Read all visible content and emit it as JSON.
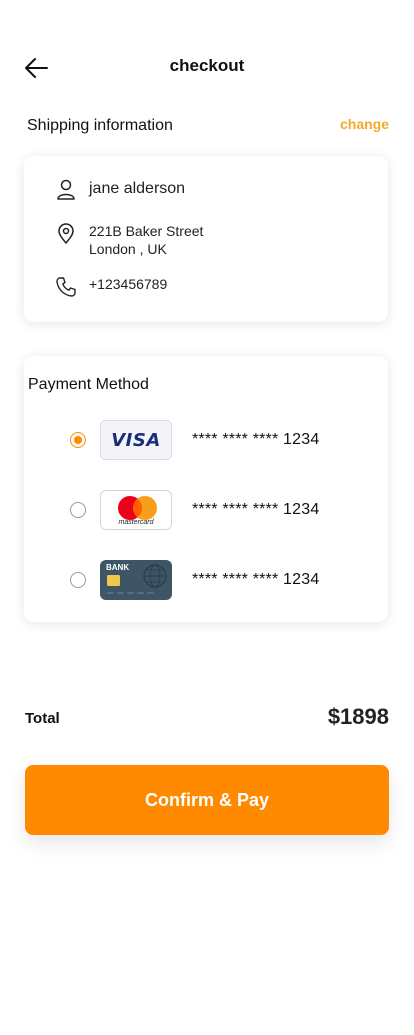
{
  "header": {
    "title": "checkout"
  },
  "shipping": {
    "title": "Shipping information",
    "change_label": "change",
    "name": "jane alderson",
    "address_line1": "221B Baker Street",
    "address_line2": "London , UK",
    "phone": "+123456789"
  },
  "payment": {
    "title": "Payment Method",
    "methods": [
      {
        "brand": "VISA",
        "masked": "**** **** **** 1234",
        "selected": true
      },
      {
        "brand": "mastercard",
        "masked": "**** **** **** 1234",
        "selected": false
      },
      {
        "brand": "BANK",
        "masked": "**** **** **** 1234",
        "selected": false
      }
    ]
  },
  "summary": {
    "total_label": "Total",
    "total_value": "$1898"
  },
  "actions": {
    "confirm_label": "Confirm & Pay"
  },
  "colors": {
    "accent": "#ff8a00",
    "link": "#f7a928",
    "bank_card": "#3e5566",
    "visa": "#1a2f7a"
  }
}
